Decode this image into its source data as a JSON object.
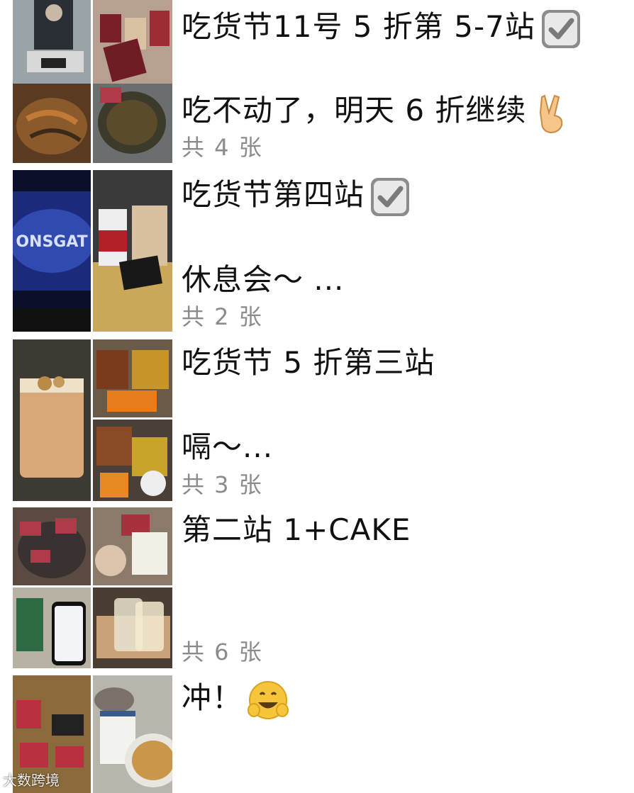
{
  "posts": [
    {
      "caption": "吃货节11号 5 折第 5-7站",
      "caption2": "",
      "count": "",
      "emoji": "check-box-icon"
    },
    {
      "caption": "吃不动了，明天 6 折继续",
      "caption2": "",
      "count": "共 4 张",
      "emoji": "victory-hand-icon"
    },
    {
      "caption": "吃货节第四站",
      "caption2": "休息会～ ...",
      "count": "共 2 张",
      "emoji": "check-box-icon"
    },
    {
      "caption": "吃货节 5 折第三站",
      "caption2": "嗝～...",
      "count": "共 3 张",
      "emoji": ""
    },
    {
      "caption": "第二站 1+CAKE",
      "caption2": "",
      "count": "共 6 张",
      "emoji": ""
    },
    {
      "caption": "冲！",
      "caption2": "",
      "count": "",
      "emoji": "grinning-face-icon"
    }
  ],
  "photo_text": {
    "cinema_screen": "ONSGAT"
  },
  "watermark": "大数跨境",
  "colors": {
    "background": "#ffffff",
    "count_text": "#8b8b8b",
    "check_box": "#8c8c8c",
    "emoji_yellow": "#f6c53b"
  }
}
